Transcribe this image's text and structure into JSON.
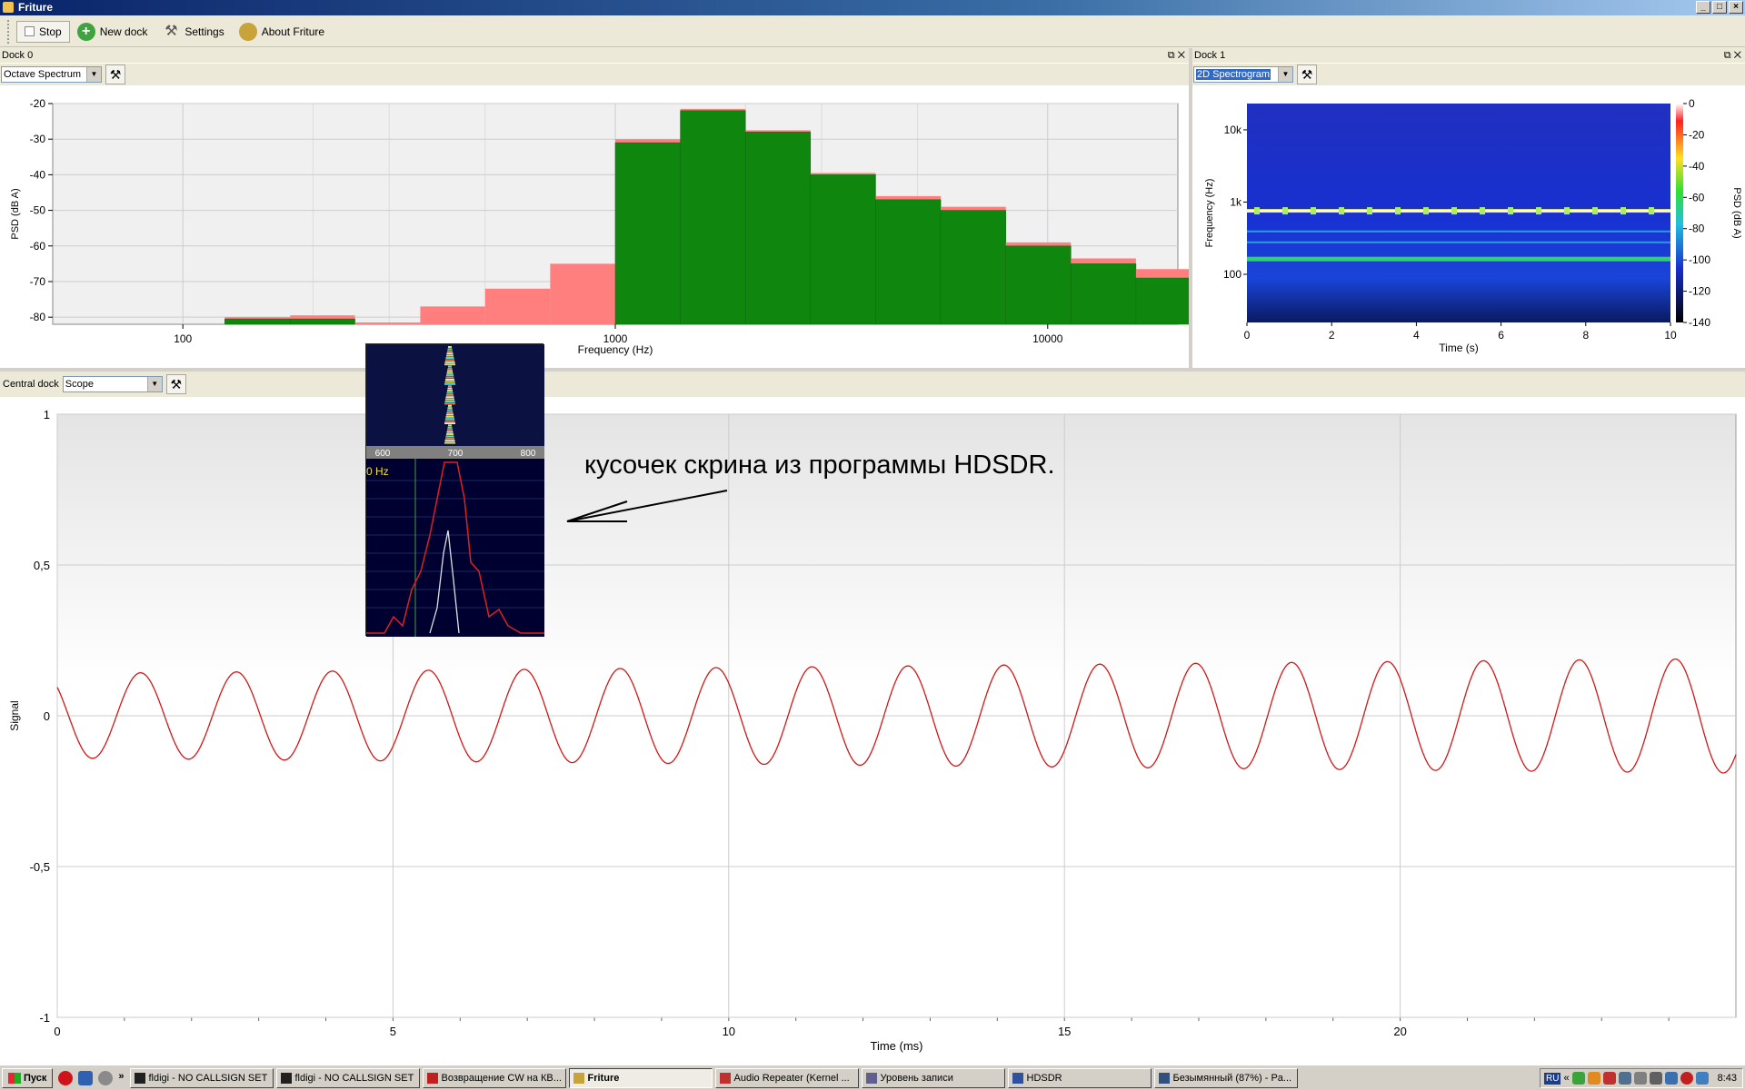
{
  "window": {
    "title": "Friture"
  },
  "toolbar": {
    "stop_label": "Stop",
    "new_dock_label": "New dock",
    "settings_label": "Settings",
    "about_label": "About Friture"
  },
  "dock0": {
    "title": "Dock 0",
    "selector_value": "Octave Spectrum",
    "chart_data": {
      "type": "bar",
      "title": "",
      "xlabel": "Frequency (Hz)",
      "ylabel": "PSD (dB A)",
      "xscale": "log",
      "xlim": [
        50,
        20000
      ],
      "ylim": [
        -82,
        -20
      ],
      "xticks": [
        "100",
        "1000",
        "10000"
      ],
      "yticks": [
        "-20",
        "-30",
        "-40",
        "-50",
        "-60",
        "-70",
        "-80"
      ],
      "bands": [
        {
          "lo": 125,
          "hi": 177,
          "value": -80.5,
          "peak": -80
        },
        {
          "lo": 177,
          "hi": 250,
          "value": -80.5,
          "peak": -79.5
        },
        {
          "lo": 250,
          "hi": 354,
          "value": -82,
          "peak": -81.5
        },
        {
          "lo": 354,
          "hi": 500,
          "value": -82,
          "peak": -77
        },
        {
          "lo": 500,
          "hi": 707,
          "value": -82,
          "peak": -72
        },
        {
          "lo": 707,
          "hi": 1000,
          "value": -82,
          "peak": -65
        },
        {
          "lo": 1000,
          "hi": 1414,
          "value": -31,
          "peak": -30
        },
        {
          "lo": 1414,
          "hi": 2000,
          "value": -22,
          "peak": -21.5
        },
        {
          "lo": 2000,
          "hi": 2828,
          "value": -28,
          "peak": -27.5
        },
        {
          "lo": 2828,
          "hi": 4000,
          "value": -40,
          "peak": -39.5
        },
        {
          "lo": 4000,
          "hi": 5657,
          "value": -47,
          "peak": -46
        },
        {
          "lo": 5657,
          "hi": 8000,
          "value": -50,
          "peak": -49
        },
        {
          "lo": 8000,
          "hi": 11314,
          "value": -60,
          "peak": -59
        },
        {
          "lo": 11314,
          "hi": 16000,
          "value": -65,
          "peak": -63.5
        },
        {
          "lo": 16000,
          "hi": 22627,
          "value": -69,
          "peak": -66.5
        }
      ],
      "series_colors": {
        "level": "#0f870f",
        "peak": "#ff7f7f"
      }
    }
  },
  "dock1": {
    "title": "Dock 1",
    "selector_value": "2D Spectrogram",
    "chart_data": {
      "type": "heatmap",
      "xlabel": "Time (s)",
      "ylabel": "Frequency (Hz)",
      "colorbar_label": "PSD (dB A)",
      "xlim": [
        0,
        10
      ],
      "xticks": [
        "0",
        "2",
        "4",
        "6",
        "8",
        "10"
      ],
      "yticks": [
        "10k",
        "1k",
        "100"
      ],
      "colorbar_ticks": [
        "0",
        "-20",
        "-40",
        "-60",
        "-80",
        "-100",
        "-120",
        "-140"
      ],
      "yscale": "log",
      "dominant_band_hz": 700
    }
  },
  "central": {
    "title": "Central dock",
    "selector_value": "Scope",
    "chart_data": {
      "type": "line",
      "xlabel": "Time (ms)",
      "ylabel": "Signal",
      "xlim": [
        0,
        25
      ],
      "ylim": [
        -1,
        1
      ],
      "xticks": [
        "0",
        "5",
        "10",
        "15",
        "20"
      ],
      "yticks": [
        "1",
        "0,5",
        "0",
        "-0,5",
        "-1"
      ],
      "series": [
        {
          "frequency_hz": 700,
          "amplitude_start": 0.14,
          "amplitude_end": 0.19,
          "color": "#d01818"
        }
      ]
    }
  },
  "inset": {
    "waterfall_ticks": [
      "600",
      "700",
      "800"
    ],
    "freq_label": "0 Hz"
  },
  "annotation": {
    "text": "кусочек скрина из программы HDSDR."
  },
  "taskbar": {
    "start_label": "Пуск",
    "more_label": "»",
    "tasks": [
      "fldigi - NO CALLSIGN SET",
      "fldigi - NO CALLSIGN SET",
      "Возвращение CW на КВ...",
      "Friture",
      "Audio Repeater (Kernel ...",
      "Уровень записи",
      "HDSDR",
      "Безымянный (87%) - Pa..."
    ],
    "tray_lang": "RU",
    "tray_expand": "«",
    "clock": "8:43"
  }
}
